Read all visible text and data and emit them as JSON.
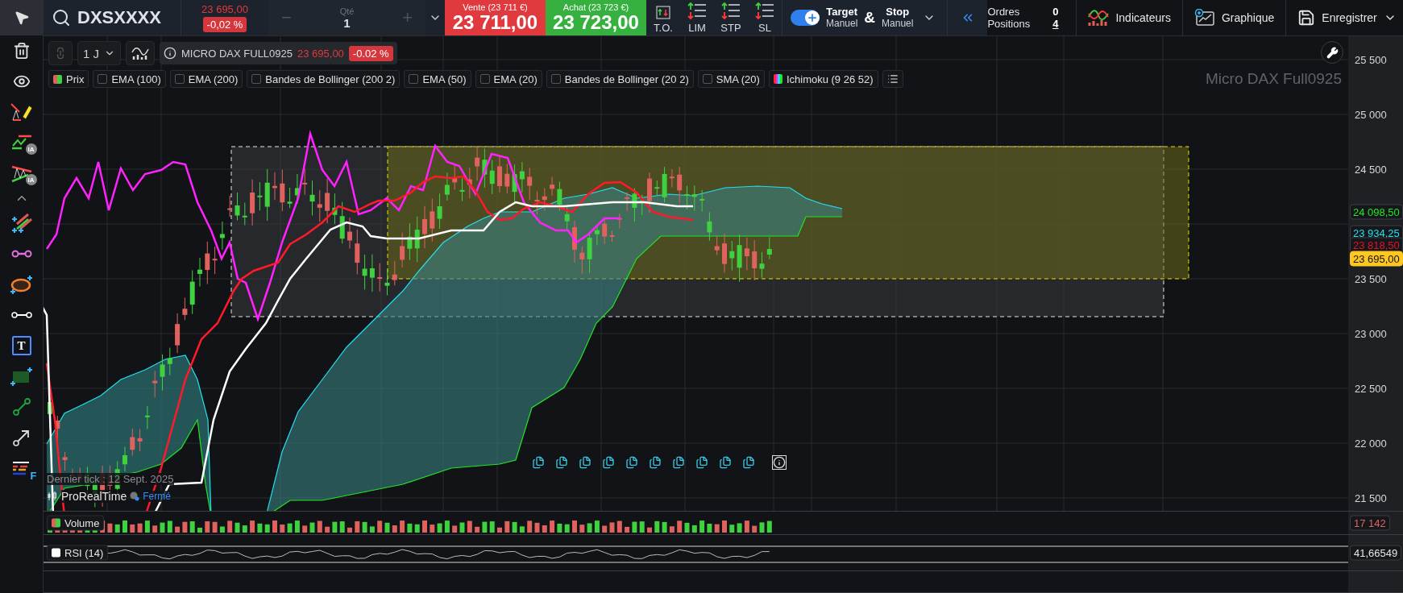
{
  "toolbar": {
    "tools": [
      {
        "kind": "pointer",
        "selected": true
      },
      {
        "kind": "trash",
        "selected": false
      },
      {
        "kind": "eye",
        "selected": false
      },
      {
        "kind": "pencil",
        "selected": false
      },
      {
        "kind": "trend",
        "badge": "IA",
        "selected": false
      },
      {
        "kind": "channel",
        "badge": "IA",
        "selected": false
      },
      {
        "kind": "collapse",
        "selected": false
      },
      {
        "kind": "fib",
        "selected": false
      },
      {
        "kind": "pink-segment",
        "selected": false
      },
      {
        "kind": "ellipse",
        "selected": false
      },
      {
        "kind": "segment",
        "selected": false
      },
      {
        "kind": "text",
        "badge": "T",
        "selected": false
      },
      {
        "kind": "rectangle",
        "selected": false
      },
      {
        "kind": "line",
        "selected": false
      },
      {
        "kind": "arrow",
        "selected": false
      },
      {
        "kind": "pattern",
        "badge": "F",
        "selected": false
      }
    ]
  },
  "instrument": {
    "symbol": "DXSXXXX",
    "price": "23 695,00",
    "change": "-0,02 %"
  },
  "quantity": {
    "minus": "−",
    "label": "Qté",
    "value": "1",
    "plus": "+"
  },
  "sell": {
    "label": "Vente (23 711 €)",
    "price": "23 711,00"
  },
  "buy": {
    "label": "Achat (23 723 €)",
    "price": "23 723,00"
  },
  "order_types": [
    {
      "kind": "to",
      "label": "T.O."
    },
    {
      "kind": "lim",
      "label": "LIM"
    },
    {
      "kind": "stp",
      "label": "STP"
    },
    {
      "kind": "sl",
      "label": "SL"
    }
  ],
  "target_stop": {
    "on": true,
    "target": "Target",
    "target_mode": "Manuel",
    "amp": "&",
    "stop": "Stop",
    "stop_mode": "Manuel"
  },
  "account": {
    "orders_label": "Ordres",
    "orders": "0",
    "positions_label": "Positions",
    "positions": "4"
  },
  "actions": [
    {
      "kind": "indicators",
      "label": "Indicateurs"
    },
    {
      "kind": "chart",
      "label": "Graphique"
    },
    {
      "kind": "save",
      "label": "Enregistrer"
    }
  ],
  "chart": {
    "timeframe": "1 J",
    "info": {
      "name": "MICRO DAX FULL0925",
      "price": "23 695,00",
      "change": "-0.02 %"
    },
    "legend": [
      {
        "kind": "swatch",
        "label": "Prix",
        "checked": true
      },
      {
        "kind": "checkbox",
        "label": "EMA (100)",
        "checked": false
      },
      {
        "kind": "checkbox",
        "label": "EMA (200)",
        "checked": false
      },
      {
        "kind": "checkbox",
        "label": "Bandes de Bollinger (200 2)",
        "checked": false
      },
      {
        "kind": "checkbox",
        "label": "EMA (50)",
        "checked": false
      },
      {
        "kind": "checkbox",
        "label": "EMA (20)",
        "checked": false
      },
      {
        "kind": "checkbox",
        "label": "Bandes de Bollinger (20 2)",
        "checked": false
      },
      {
        "kind": "checkbox",
        "label": "SMA (20)",
        "checked": false
      },
      {
        "kind": "rainbow",
        "label": "Ichimoku (9 26 52)",
        "checked": true
      }
    ],
    "watermark": "Micro DAX Full0925",
    "last_tick": "Dernier tick : 12 Sept. 2025",
    "provider": "ProRealTime",
    "market_status": "Fermé",
    "y_ticks": [
      "25 500",
      "25 000",
      "24 500",
      "23 500",
      "23 000",
      "22 500",
      "22 000",
      "21 500"
    ],
    "price_tags": [
      {
        "value": "24 098,50",
        "color": "#22e622",
        "kind": "outline"
      },
      {
        "value": "23 934,25",
        "color": "#22e0f0",
        "kind": "outline"
      },
      {
        "value": "23 818,50",
        "color": "#e8102a",
        "kind": "outline"
      },
      {
        "value": "23 695,00",
        "color": "#ffc820",
        "kind": "filled"
      }
    ],
    "volume": {
      "label": "Volume",
      "value": "17 142"
    },
    "rsi": {
      "label": "RSI (14)",
      "value": "41,66549"
    }
  }
}
